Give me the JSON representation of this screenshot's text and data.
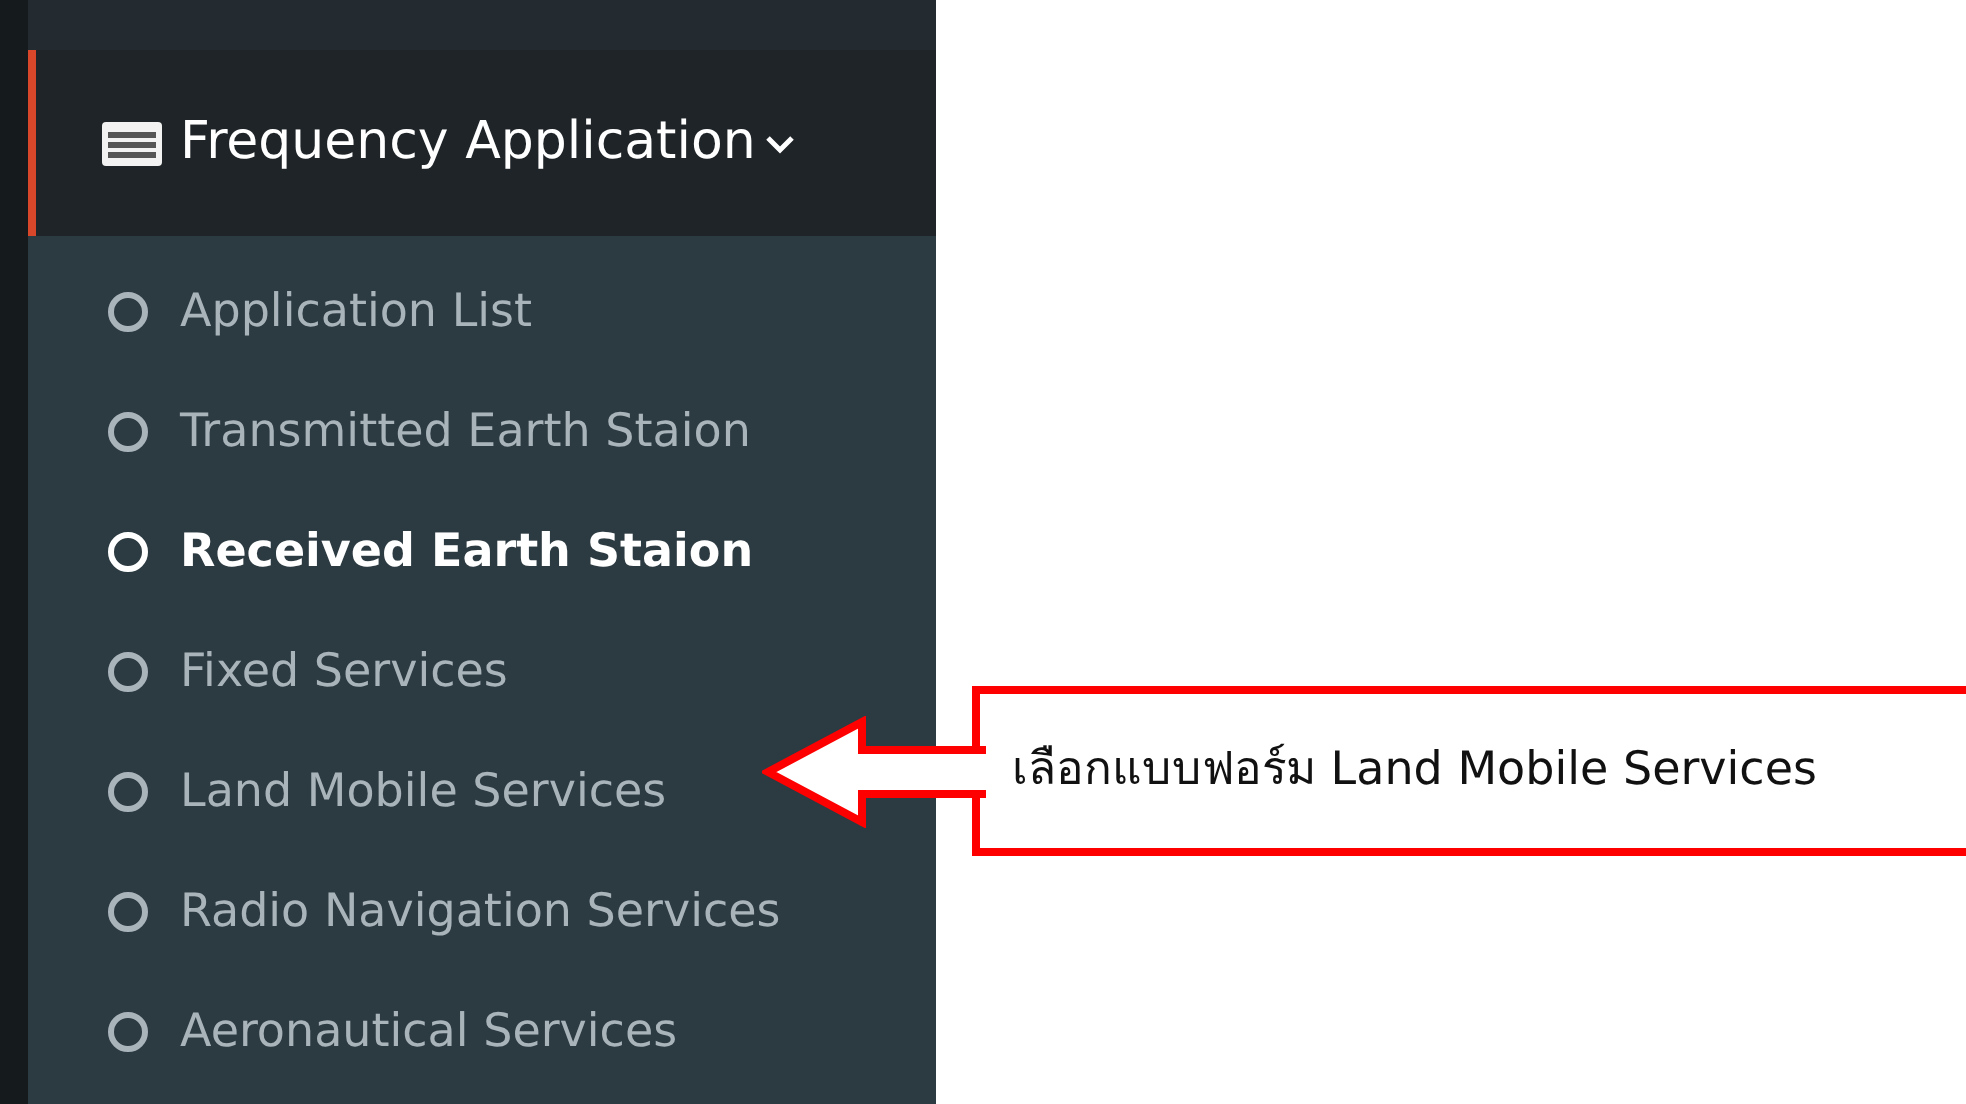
{
  "menu_header": {
    "title": "Frequency Application",
    "expanded": true
  },
  "menu_items": [
    {
      "label": "Application List",
      "selected": false
    },
    {
      "label": "Transmitted Earth Staion",
      "selected": false
    },
    {
      "label": "Received Earth Staion",
      "selected": true
    },
    {
      "label": "Fixed Services",
      "selected": false
    },
    {
      "label": "Land Mobile Services",
      "selected": false
    },
    {
      "label": "Radio Navigation Services",
      "selected": false
    },
    {
      "label": "Aeronautical Services",
      "selected": false
    }
  ],
  "callout": {
    "text": "เลือกแบบฟอร์ม Land Mobile Services"
  }
}
